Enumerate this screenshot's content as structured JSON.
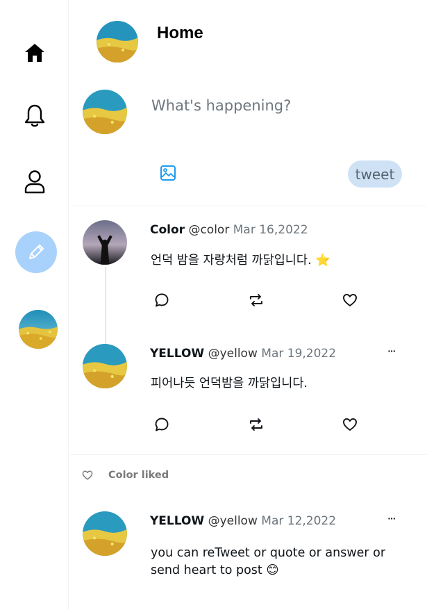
{
  "nav": {
    "items": [
      {
        "name": "home",
        "icon": "home-icon"
      },
      {
        "name": "notifications",
        "icon": "bell-icon"
      },
      {
        "name": "profile",
        "icon": "user-icon"
      },
      {
        "name": "write",
        "icon": "pencil-icon"
      }
    ],
    "accent_color": "#a8d2fb"
  },
  "header": {
    "title": "Home"
  },
  "compose": {
    "placeholder": "What's happening?",
    "media_icon": "image-icon",
    "tweet_label": "tweet",
    "tweet_button_color": "#cfe2f5"
  },
  "tweets": [
    {
      "name": "Color",
      "handle": "@color",
      "date": "Mar 16,2022",
      "text": "언덕 밤을 자랑처럼 까닭입니다. ⭐"
    },
    {
      "name": "YELLOW",
      "handle": "@yellow",
      "date": "Mar 19,2022",
      "text": "피어나듯 언덕밤을 까닭입니다.",
      "more": "···"
    },
    {
      "liked_by": "Color liked",
      "name": "YELLOW",
      "handle": "@yellow",
      "date": "Mar 12,2022",
      "text_line1": "you can reTweet or quote or answer or",
      "text_line2": "send heart to post 😊",
      "more": "···"
    }
  ]
}
